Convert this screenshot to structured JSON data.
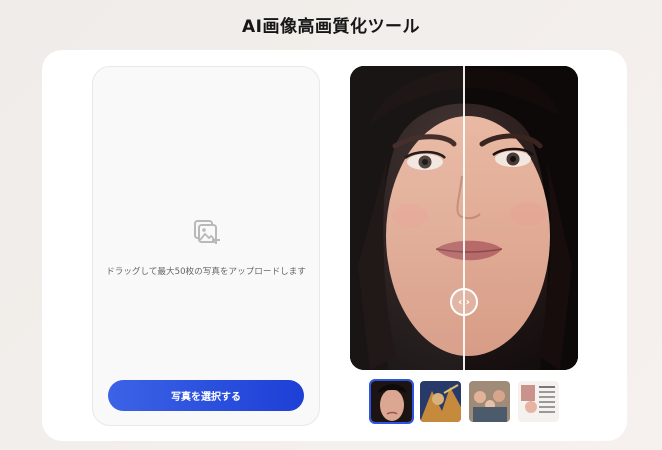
{
  "page": {
    "title": "AI画像高画質化ツール"
  },
  "upload": {
    "icon": "add-image-icon",
    "instruction": "ドラッグして最大50枚の写真をアップロードします",
    "button_label": "写真を選択する"
  },
  "compare": {
    "handle_icon": "left-right-arrows-icon",
    "handle_glyph": "‹ ›"
  },
  "thumbnails": [
    {
      "name": "woman-portrait",
      "active": true
    },
    {
      "name": "fantasy-art",
      "active": false
    },
    {
      "name": "family-photo",
      "active": false
    },
    {
      "name": "magazine-page",
      "active": false
    }
  ],
  "colors": {
    "accent": "#2e54e4",
    "button_gradient_start": "#3c63e6",
    "button_gradient_end": "#1d3fd6"
  }
}
